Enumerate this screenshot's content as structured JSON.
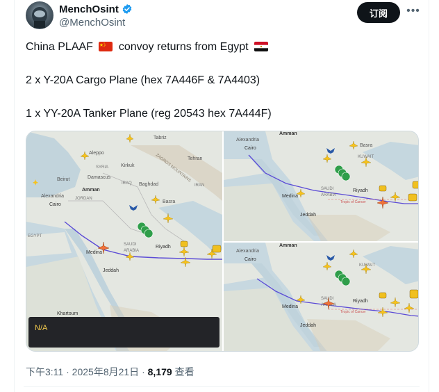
{
  "author": {
    "display_name": "MenchOsint",
    "handle": "@MenchOsint",
    "verified": true
  },
  "follow_button": {
    "label": "订阅"
  },
  "more_button": {
    "icon": "more-horizontal-icon"
  },
  "tweet": {
    "line1_before_flag": "China PLAAF",
    "line1_middle": "convoy returns from Egypt",
    "line2": "2 x Y-20A Cargo Plane (hex 7A446F & 7A4403)",
    "line3": "1 x YY-20A Tanker Plane (reg 20543 hex 7A444F)"
  },
  "flags": {
    "china": "china-flag-icon",
    "egypt": "egypt-flag-icon"
  },
  "map_labels": {
    "big": [
      "Aleppo",
      "Tabriz",
      "Tehran",
      "SYRIA",
      "Kirkuk",
      "Beirut",
      "Damascus",
      "Baghdad",
      "IRAQ",
      "IRAN",
      "Amman",
      "JORDAN",
      "Alexandria",
      "Cairo",
      "Basra",
      "EGYPT",
      "SAUDI",
      "ARABIA",
      "Riyadh",
      "Medina",
      "Jeddah",
      "Khartoum",
      "ZAGROS MOUNTAINS"
    ],
    "top_right": [
      "Amman",
      "Alexandria",
      "Cairo",
      "Basra",
      "SAUDI",
      "ARABIA",
      "Riyadh",
      "Medina",
      "Jeddah",
      "KUWAIT",
      "Tropic of Cancer"
    ],
    "bottom_right": [
      "Amman",
      "Alexandria",
      "Cairo",
      "KUWAIT",
      "SAUDI",
      "ARABIA",
      "Riyadh",
      "Medina",
      "Jeddah",
      "Tropic of Cancer"
    ]
  },
  "media_overlay": {
    "label": "N/A"
  },
  "meta": {
    "time": "下午3:11",
    "date": "2025年8月21日",
    "sep": "·",
    "views_count": "8,179",
    "views_label": "查看"
  },
  "colors": {
    "accent": "#1d9bf0",
    "text": "#0f1419",
    "muted": "#536471",
    "track": "#5b4bd6",
    "plane_yellow": "#f6c21c",
    "plane_orange": "#f0723a",
    "na_text": "#f2c94c"
  }
}
